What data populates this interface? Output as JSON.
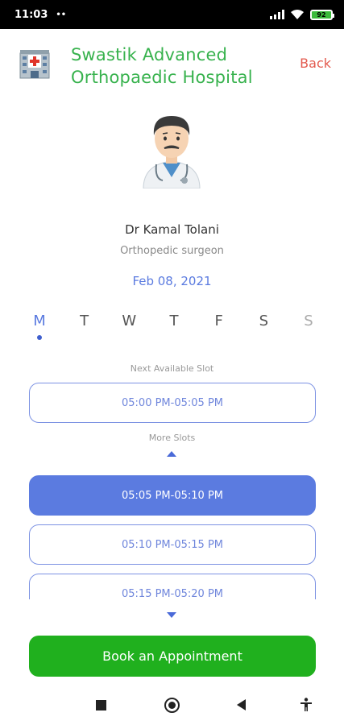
{
  "status_bar": {
    "time": "11:03",
    "notification_dots": "••",
    "battery": "92"
  },
  "header": {
    "hospital_name": "Swastik Advanced Orthopaedic Hospital",
    "back_label": "Back",
    "hospital_icon": "hospital-icon"
  },
  "doctor": {
    "avatar_icon": "doctor-avatar-icon",
    "name": "Dr Kamal Tolani",
    "role": "Orthopedic surgeon",
    "date": "Feb 08, 2021"
  },
  "days": [
    {
      "label": "M",
      "selected": true
    },
    {
      "label": "T",
      "selected": false
    },
    {
      "label": "W",
      "selected": false
    },
    {
      "label": "T",
      "selected": false
    },
    {
      "label": "F",
      "selected": false
    },
    {
      "label": "S",
      "selected": false
    },
    {
      "label": "S",
      "selected": false
    }
  ],
  "slots": {
    "next_label": "Next Available Slot",
    "next_slot": "05:00 PM-05:05 PM",
    "more_label": "More Slots",
    "more": [
      {
        "time": "05:05 PM-05:10 PM",
        "selected": true
      },
      {
        "time": "05:10 PM-05:15 PM",
        "selected": false
      },
      {
        "time": "05:15 PM-05:20 PM",
        "selected": false
      }
    ]
  },
  "book_button": "Book an Appointment",
  "colors": {
    "brand_green": "#37b24d",
    "accent_blue": "#5b7be0",
    "back_red": "#e35b4f",
    "book_green": "#20b01e"
  }
}
